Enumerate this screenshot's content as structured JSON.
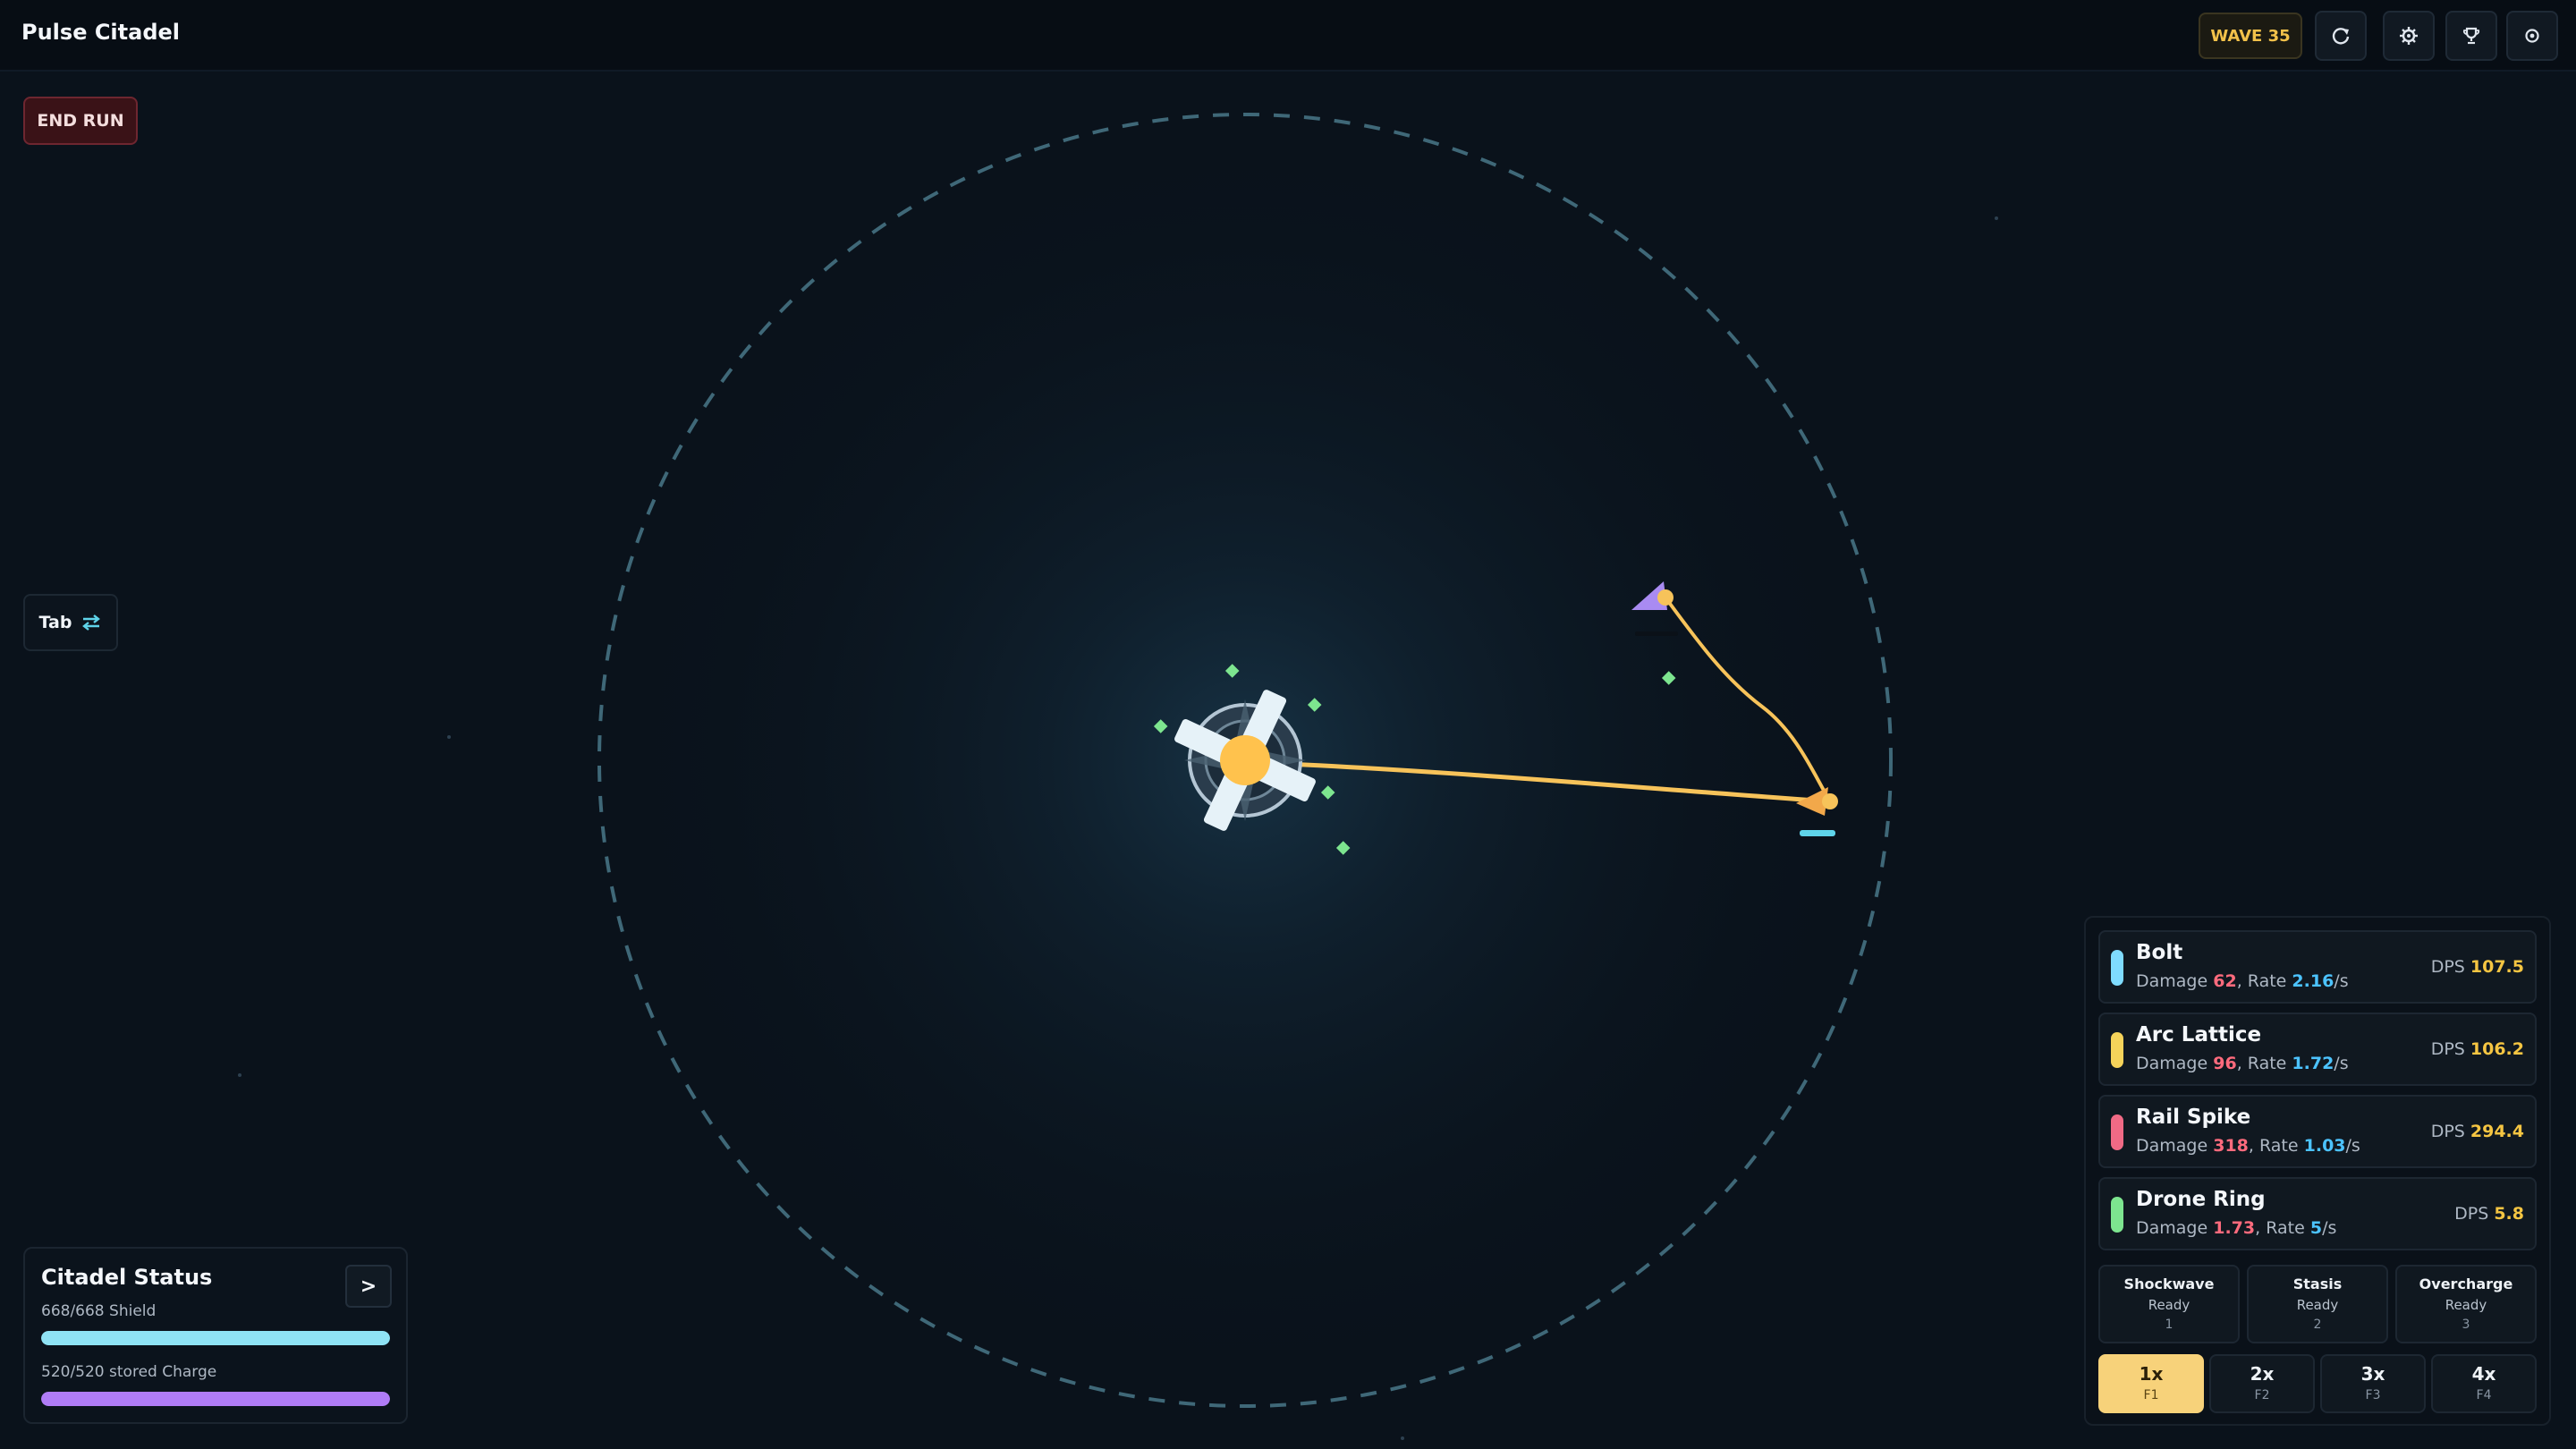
{
  "header": {
    "title": "Pulse Citadel",
    "wave": "WAVE 35",
    "icons": [
      "restart-icon",
      "gear-icon",
      "trophy-icon",
      "settings-icon"
    ]
  },
  "controls": {
    "end_run": "END RUN",
    "tab_label": "Tab",
    "tab_icon": "swap-arrows-icon"
  },
  "citadel_status": {
    "title": "Citadel Status",
    "collapse": ">",
    "shield_text": "668/668 Shield",
    "shield_fraction": 1.0,
    "shield_color": "#8fe3f5",
    "charge_text": "520/520 stored Charge",
    "charge_fraction": 1.0,
    "charge_color": "#b07cf6"
  },
  "weapons": [
    {
      "name": "Bolt",
      "damage": "62",
      "rate": "2.16",
      "dps": "107.5",
      "color": "#7fdcff"
    },
    {
      "name": "Arc Lattice",
      "damage": "96",
      "rate": "1.72",
      "dps": "106.2",
      "color": "#f5d35a"
    },
    {
      "name": "Rail Spike",
      "damage": "318",
      "rate": "1.03",
      "dps": "294.4",
      "color": "#f06a85"
    },
    {
      "name": "Drone Ring",
      "damage": "1.73",
      "rate": "5",
      "dps": "5.8",
      "color": "#7de58f"
    }
  ],
  "weapon_labels": {
    "damage": "Damage",
    "rate": "Rate",
    "per_sec": "/s",
    "dps": "DPS"
  },
  "abilities": [
    {
      "name": "Shockwave",
      "state": "Ready",
      "key": "1"
    },
    {
      "name": "Stasis",
      "state": "Ready",
      "key": "2"
    },
    {
      "name": "Overcharge",
      "state": "Ready",
      "key": "3"
    }
  ],
  "speeds": [
    {
      "label": "1x",
      "key": "F1",
      "active": true
    },
    {
      "label": "2x",
      "key": "F2",
      "active": false
    },
    {
      "label": "3x",
      "key": "F3",
      "active": false
    },
    {
      "label": "4x",
      "key": "F4",
      "active": false
    }
  ],
  "colors": {
    "accent_gold": "#f5c542",
    "beam": "#f7c35a",
    "drone": "#7de58f",
    "enemy_violet": "#a98bf2",
    "range_ring": "#3f6878"
  }
}
